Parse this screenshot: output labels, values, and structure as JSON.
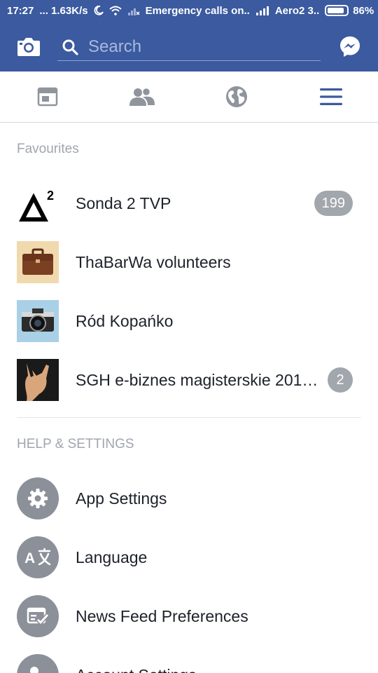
{
  "status_bar": {
    "time": "17:27",
    "speed": "... 1.63K/s",
    "carrier_msg": "Emergency calls on..",
    "carrier2": "Aero2 3..",
    "battery": "86%",
    "battery_level": 0.86
  },
  "header": {
    "search_placeholder": "Search",
    "camera_icon": "camera-icon",
    "messenger_icon": "messenger-icon"
  },
  "tabs": [
    {
      "name": "news-feed-icon"
    },
    {
      "name": "friends-icon"
    },
    {
      "name": "globe-icon"
    },
    {
      "name": "menu-icon",
      "active": true
    }
  ],
  "favourites": {
    "title": "Favourites",
    "items": [
      {
        "label": "Sonda 2 TVP",
        "badge": "199",
        "thumb": "sonda-logo"
      },
      {
        "label": "ThaBarWa volunteers",
        "badge": "",
        "thumb": "briefcase"
      },
      {
        "label": "Ród Kopańko",
        "badge": "",
        "thumb": "camera-photo"
      },
      {
        "label": "SGH e-biznes magisterskie 201…",
        "badge": "2",
        "thumb": "rock-hand"
      }
    ]
  },
  "help_settings": {
    "title": "HELP & SETTINGS",
    "items": [
      {
        "label": "App Settings",
        "icon": "gear-icon"
      },
      {
        "label": "Language",
        "icon": "translate-icon"
      },
      {
        "label": "News Feed Preferences",
        "icon": "news-feed-preferences-icon"
      },
      {
        "label": "Account Settings",
        "icon": "account-settings-icon"
      }
    ]
  },
  "colors": {
    "brand": "#3b5a9f",
    "badge": "#a2a6ad",
    "icon_circle": "#8b9099"
  }
}
